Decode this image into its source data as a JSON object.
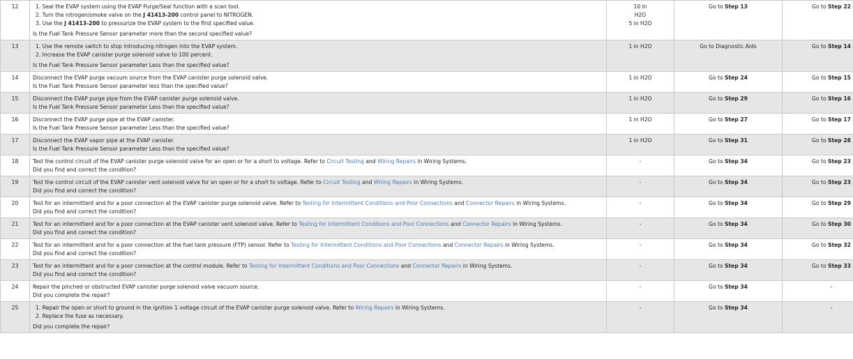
{
  "rows": [
    {
      "num": "12",
      "items": [
        "1. Seal the EVAP system using the EVAP Purge/Seal function with a scan tool.",
        [
          "2. Turn the nitrogen/smoke valve on the ",
          "J 41413-200",
          " control panel to NITROGEN."
        ],
        [
          "3. Use the ",
          "J 41413-200",
          " to pressurize the EVAP system to the first specified value."
        ]
      ],
      "question": "Is the Fuel Tank Pressure Sensor parameter more than the second specified value?",
      "values": [
        "10 in",
        "H2O",
        "5 in H2O"
      ],
      "yes": {
        "text": "Go to ",
        "step": "Step 13"
      },
      "no": {
        "text": "Go to ",
        "step": "Step 22"
      }
    },
    {
      "num": "13",
      "items": [
        "1. Use the remote switch to stop introducing nitrogen into the EVAP system.",
        "2. Increase the EVAP canister purge solenoid valve to 100 percent."
      ],
      "question": "Is the Fuel Tank Pressure Sensor parameter Less than the specified value?",
      "values": [
        "1 in H2O"
      ],
      "yes": {
        "text": "Go to Diagnostic Aids",
        "step": ""
      },
      "no": {
        "text": "Go to ",
        "step": "Step 14"
      }
    },
    {
      "num": "14",
      "action": "Disconnect the EVAP purge vacuum source from the EVAP canister purge solenoid valve.",
      "question": "Is the Fuel Tank Pressure Sensor parameter less than the specified value?",
      "values": [
        "1 in H2O"
      ],
      "yes": {
        "text": "Go to ",
        "step": "Step 24"
      },
      "no": {
        "text": "Go to ",
        "step": "Step 15"
      }
    },
    {
      "num": "15",
      "action": "Disconnect the EVAP purge pipe from the EVAP canister purge solenoid valve.",
      "question": "Is the Fuel Tank Pressure Sensor parameter Less than the specified value?",
      "values": [
        "1 in H2O"
      ],
      "yes": {
        "text": "Go to ",
        "step": "Step 29"
      },
      "no": {
        "text": "Go to ",
        "step": "Step 16"
      }
    },
    {
      "num": "16",
      "action": "Disconnect the EVAP purge pipe at the EVAP canister.",
      "question": "Is the Fuel Tank Pressure Sensor parameter Less than the specified value?",
      "values": [
        "1 in H2O"
      ],
      "yes": {
        "text": "Go to ",
        "step": "Step 27"
      },
      "no": {
        "text": "Go to ",
        "step": "Step 17"
      }
    },
    {
      "num": "17",
      "action": "Disconnect the EVAP vapor pipe at the EVAP canister.",
      "question": "Is the Fuel Tank Pressure Sensor parameter Less than the specified value?",
      "values": [
        "1 in H2O"
      ],
      "yes": {
        "text": "Go to ",
        "step": "Step 31"
      },
      "no": {
        "text": "Go to ",
        "step": "Step 28"
      }
    },
    {
      "num": "18",
      "action_parts": [
        "Test the control circuit of the EVAP canister purge solenoid valve for an open or for a short to voltage. Refer to ",
        "Circuit Testing",
        " and ",
        "Wiring Repairs",
        " in Wiring Systems."
      ],
      "question": "Did you find and correct the condition?",
      "values": [
        "-"
      ],
      "yes": {
        "text": "Go to ",
        "step": "Step 34"
      },
      "no": {
        "text": "Go to ",
        "step": "Step 23"
      }
    },
    {
      "num": "19",
      "action_parts": [
        "Test the control circuit of the EVAP canister vent solenoid valve for an open or for a short to voltage. Refer to ",
        "Circuit Testing",
        " and ",
        "Wiring Repairs",
        " in Wiring Systems."
      ],
      "question": "Did you find and correct the condition?",
      "values": [
        "-"
      ],
      "yes": {
        "text": "Go to ",
        "step": "Step 34"
      },
      "no": {
        "text": "Go to ",
        "step": "Step 23"
      }
    },
    {
      "num": "20",
      "action_parts": [
        "Test for an intermittent and for a poor connection at the EVAP canister purge solenoid valve. Refer to ",
        "Testing for Intermittent Conditions and Poor Connections",
        " and ",
        "Connector Repairs",
        " in Wiring Systems."
      ],
      "question": "Did you find and correct the condition?",
      "values": [
        "-"
      ],
      "yes": {
        "text": "Go to ",
        "step": "Step 34"
      },
      "no": {
        "text": "Go to ",
        "step": "Step 29"
      }
    },
    {
      "num": "21",
      "action_parts": [
        "Test for an intermittent and for a poor connection at the EVAP canister vent solenoid valve. Refer to ",
        "Testing for Intermittent Conditions and Poor Connections",
        " and ",
        "Connector Repairs",
        " in Wiring Systems."
      ],
      "question": "Did you find and correct the condition?",
      "values": [
        "-"
      ],
      "yes": {
        "text": "Go to ",
        "step": "Step 34"
      },
      "no": {
        "text": "Go to ",
        "step": "Step 30"
      }
    },
    {
      "num": "22",
      "action_parts": [
        "Test for an intermittent and for a poor connection at the fuel tank pressure (FTP) sensor. Refer to ",
        "Testing for Intermittent Conditions and Poor Connections",
        " and ",
        "Connector Repairs",
        " in Wiring Systems."
      ],
      "question": "Did you find and correct the condition?",
      "values": [
        "-"
      ],
      "yes": {
        "text": "Go to ",
        "step": "Step 34"
      },
      "no": {
        "text": "Go to ",
        "step": "Step 32"
      }
    },
    {
      "num": "23",
      "action_parts": [
        "Test for an intermittent and for a poor connection at the control module. Refer to ",
        "Testing for Intermittent Conditions and Poor Connections",
        " and ",
        "Connector Repairs",
        " in Wiring Systems."
      ],
      "question": "Did you find and correct the condition?",
      "values": [
        "-"
      ],
      "yes": {
        "text": "Go to ",
        "step": "Step 34"
      },
      "no": {
        "text": "Go to ",
        "step": "Step 33"
      }
    },
    {
      "num": "24",
      "action": "Repair the pinched or obstructed EVAP canister purge solenoid valve vacuum source.",
      "question": "Did you complete the repair?",
      "values": [
        "-"
      ],
      "yes": {
        "text": "Go to ",
        "step": "Step 34"
      },
      "no": {
        "text": "-",
        "step": ""
      }
    },
    {
      "num": "25",
      "items": [
        [
          "1. Repair the open or short to ground in the ignition 1 voltage circuit of the EVAP canister purge solenoid valve. Refer to ",
          "Wiring Repairs",
          " in Wiring Systems."
        ],
        "2. Replace the fuse as necessary."
      ],
      "question": "Did you complete the repair?",
      "values": [
        "-"
      ],
      "yes": {
        "text": "Go to ",
        "step": "Step 34"
      },
      "no": {
        "text": "-",
        "step": ""
      }
    }
  ]
}
